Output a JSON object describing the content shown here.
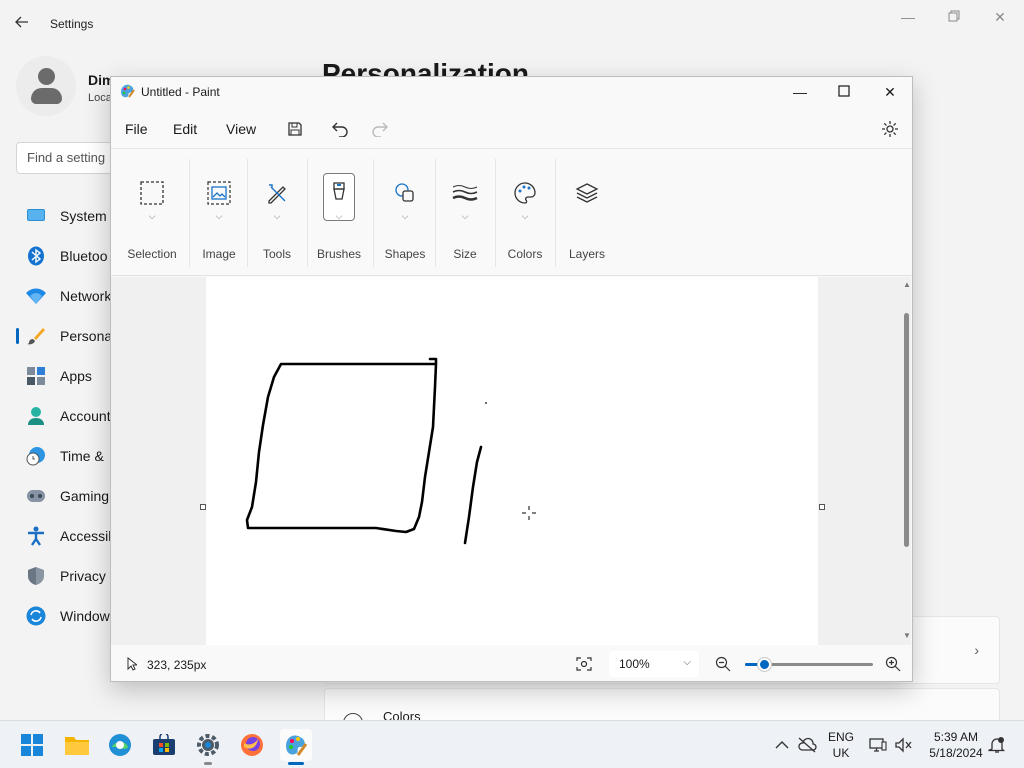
{
  "settings": {
    "title": "Settings",
    "user_name": "Dim",
    "user_sub": "Loca",
    "search_placeholder": "Find a setting",
    "page_title": "Personalization",
    "nav": [
      {
        "label": "System",
        "icon": "monitor-icon",
        "active": false
      },
      {
        "label": "Bluetoo",
        "icon": "bluetooth-icon",
        "active": false
      },
      {
        "label": "Network",
        "icon": "wifi-icon",
        "active": false
      },
      {
        "label": "Persona",
        "icon": "brush-icon",
        "active": true
      },
      {
        "label": "Apps",
        "icon": "apps-icon",
        "active": false
      },
      {
        "label": "Account",
        "icon": "person-icon",
        "active": false
      },
      {
        "label": "Time &",
        "icon": "clock-globe-icon",
        "active": false
      },
      {
        "label": "Gaming",
        "icon": "gamepad-icon",
        "active": false
      },
      {
        "label": "Accessib",
        "icon": "accessibility-icon",
        "active": false
      },
      {
        "label": "Privacy &",
        "icon": "shield-icon",
        "active": false
      },
      {
        "label": "Window",
        "icon": "windows-update-icon",
        "active": false
      }
    ],
    "colors_card_label": "Colors"
  },
  "paint": {
    "title": "Untitled - Paint",
    "menu": {
      "file": "File",
      "edit": "Edit",
      "view": "View"
    },
    "ribbon": {
      "selection": "Selection",
      "image": "Image",
      "tools": "Tools",
      "brushes": "Brushes",
      "shapes": "Shapes",
      "size": "Size",
      "colors": "Colors",
      "layers": "Layers"
    },
    "status": {
      "cursor_position": "323, 235px",
      "zoom": "100%",
      "zoom_level": 0.15
    }
  },
  "taskbar": {
    "lang_top": "ENG",
    "lang_bottom": "UK",
    "time": "5:39 AM",
    "date": "5/18/2024",
    "apps": [
      "start-icon",
      "file-explorer-icon",
      "edge-icon",
      "store-icon",
      "settings-icon",
      "firefox-icon",
      "paint-icon"
    ]
  },
  "colors": {
    "accent": "#0067c0",
    "active_taskbar_app": "paint"
  }
}
